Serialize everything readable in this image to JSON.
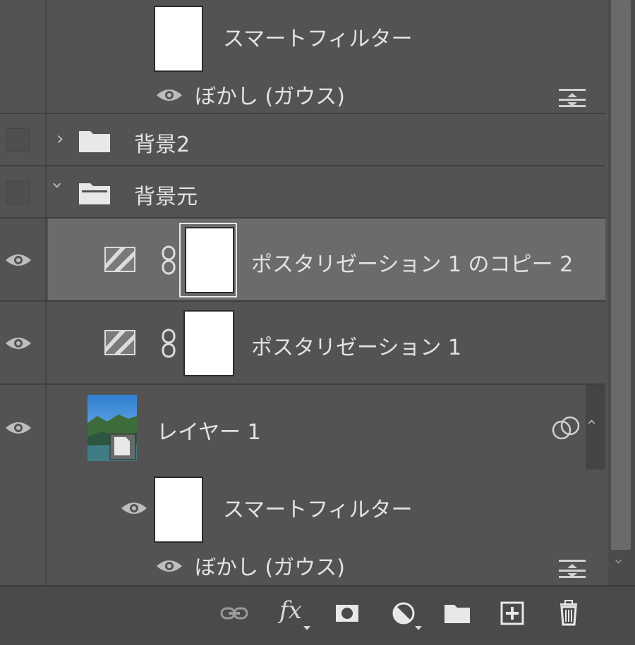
{
  "layers": {
    "smart_filter_top": {
      "label": "スマートフィルター"
    },
    "blur_top": {
      "label": "ぼかし (ガウス)"
    },
    "group_bg2": {
      "label": "背景2"
    },
    "group_bgmoto": {
      "label": "背景元"
    },
    "posterize_copy": {
      "label": "ポスタリゼーション 1 のコピー 2"
    },
    "posterize": {
      "label": "ポスタリゼーション 1"
    },
    "layer1": {
      "label": "レイヤー 1"
    },
    "smart_filter_bottom": {
      "label": "スマートフィルター"
    },
    "blur_bottom": {
      "label": "ぼかし (ガウス)"
    }
  },
  "colors": {
    "panel_bg": "#535353",
    "selected_row": "#6b6b6b",
    "text": "#e3e3e3",
    "icon": "#d0d0d0"
  },
  "footer": {
    "icons": [
      "link-layers-icon",
      "fx-icon",
      "add-mask-icon",
      "adjustment-layer-icon",
      "new-group-icon",
      "new-layer-icon",
      "trash-icon"
    ]
  }
}
